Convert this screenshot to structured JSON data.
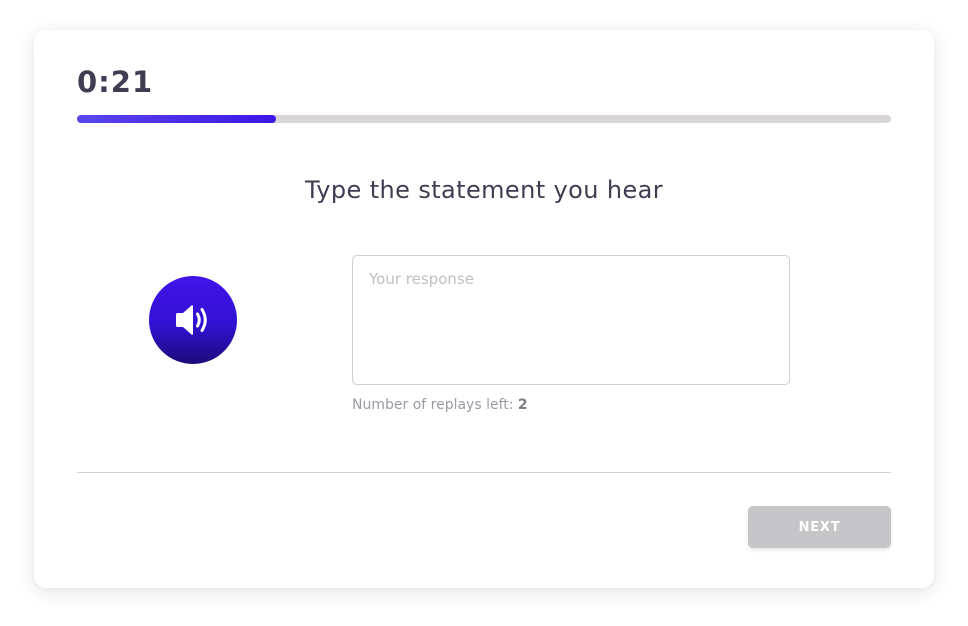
{
  "timer": {
    "value": "0:21"
  },
  "progress": {
    "fraction": 0.245
  },
  "question": {
    "prompt": "Type the statement you hear"
  },
  "audio": {
    "icon": "speaker-volume-icon",
    "colors": {
      "top": "#4213ea",
      "bottom": "#1d0b7a"
    }
  },
  "response": {
    "placeholder": "Your response",
    "value": ""
  },
  "replays": {
    "label": "Number of replays left: ",
    "count": "2"
  },
  "footer": {
    "next_label": "NEXT"
  },
  "colors": {
    "accent": "#3d16e6",
    "text": "#3e3d52",
    "track": "#d9d5d8",
    "button_disabled": "#c6c6c9"
  }
}
